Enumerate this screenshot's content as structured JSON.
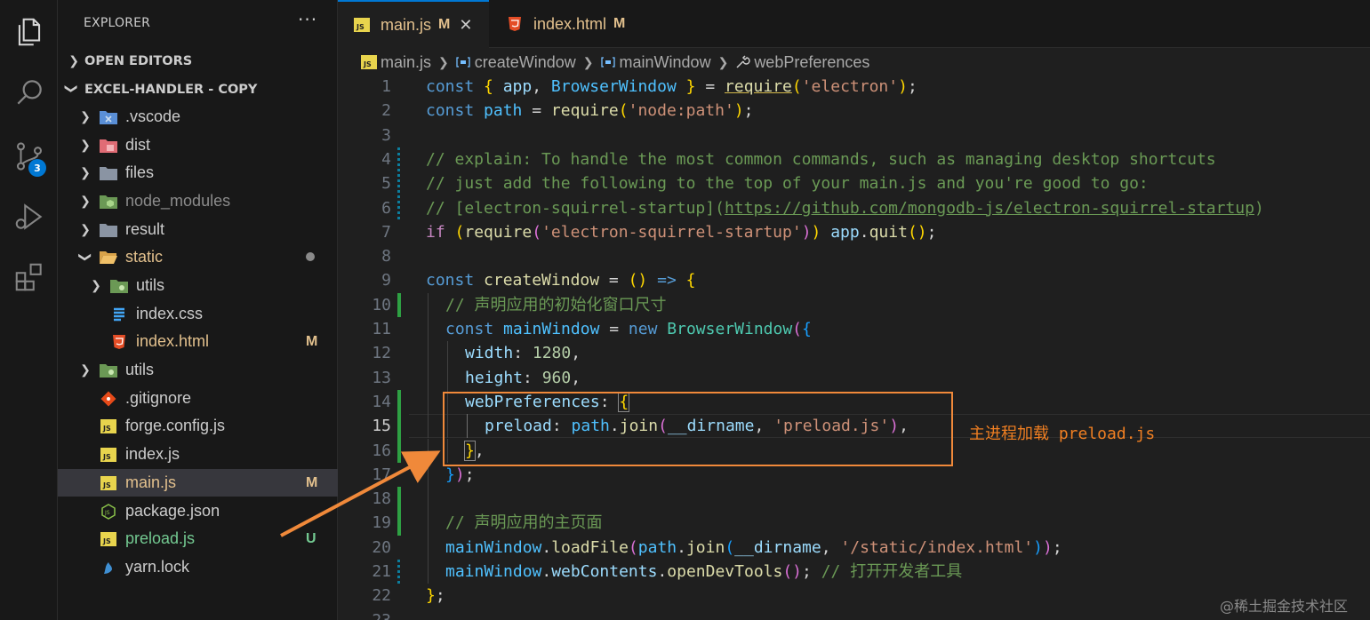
{
  "sidebar": {
    "title": "EXPLORER",
    "more": "···",
    "open_editors": "OPEN EDITORS",
    "project": "EXCEL-HANDLER - COPY",
    "items": [
      {
        "label": ".vscode",
        "status": "",
        "icon": "vscode-folder-icon"
      },
      {
        "label": "dist",
        "status": "",
        "icon": "dist-folder-icon"
      },
      {
        "label": "files",
        "status": "",
        "icon": "folder-icon"
      },
      {
        "label": "node_modules",
        "status": "",
        "icon": "node-folder-icon"
      },
      {
        "label": "result",
        "status": "",
        "icon": "folder-icon"
      },
      {
        "label": "static",
        "status": "",
        "icon": "folder-open-icon"
      },
      {
        "label": "utils",
        "status": "",
        "icon": "utils-folder-icon"
      },
      {
        "label": "index.css",
        "status": "",
        "icon": "css-file-icon"
      },
      {
        "label": "index.html",
        "status": "M",
        "icon": "html-file-icon"
      },
      {
        "label": "utils",
        "status": "",
        "icon": "utils-folder-icon"
      },
      {
        "label": ".gitignore",
        "status": "",
        "icon": "git-file-icon"
      },
      {
        "label": "forge.config.js",
        "status": "",
        "icon": "js-file-icon"
      },
      {
        "label": "index.js",
        "status": "",
        "icon": "js-file-icon"
      },
      {
        "label": "main.js",
        "status": "M",
        "icon": "js-file-icon"
      },
      {
        "label": "package.json",
        "status": "",
        "icon": "node-file-icon"
      },
      {
        "label": "preload.js",
        "status": "U",
        "icon": "js-file-icon"
      },
      {
        "label": "yarn.lock",
        "status": "",
        "icon": "yarn-file-icon"
      }
    ]
  },
  "activity": {
    "scm_badge": "3"
  },
  "tabs": [
    {
      "label": "main.js",
      "status": "M",
      "close": "✕"
    },
    {
      "label": "index.html",
      "status": "M"
    }
  ],
  "breadcrumb": [
    "main.js",
    "createWindow",
    "mainWindow",
    "webPreferences"
  ],
  "line_numbers": [
    "1",
    "2",
    "3",
    "4",
    "5",
    "6",
    "7",
    "8",
    "9",
    "10",
    "11",
    "12",
    "13",
    "14",
    "15",
    "16",
    "17",
    "18",
    "19",
    "20",
    "21",
    "22",
    "23"
  ],
  "code": {
    "l1": [
      "const",
      "{",
      "app",
      "BrowserWindow",
      "}",
      "require",
      "'electron'"
    ],
    "l2": [
      "const",
      "path",
      "require",
      "'node:path'"
    ],
    "l4": "// explain: To handle the most common commands, such as managing desktop shortcuts",
    "l5": "// just add the following to the top of your main.js and you're good to go:",
    "l6a": "// [electron-squirrel-startup](",
    "l6b": "https://github.com/mongodb-js/electron-squirrel-startup",
    "l6c": ")",
    "l7": [
      "if",
      "require",
      "'electron-squirrel-startup'",
      "app",
      "quit"
    ],
    "l9": [
      "const",
      "createWindow",
      "=>"
    ],
    "l10": "// 声明应用的初始化窗口尺寸",
    "l11": [
      "const",
      "mainWindow",
      "new",
      "BrowserWindow"
    ],
    "l12": [
      "width",
      "1280"
    ],
    "l13": [
      "height",
      "960"
    ],
    "l14": [
      "webPreferences"
    ],
    "l15": [
      "preload",
      "path",
      "join",
      "__dirname",
      "'preload.js'"
    ],
    "l19": "// 声明应用的主页面",
    "l20": [
      "mainWindow",
      "loadFile",
      "path",
      "join",
      "__dirname",
      "'/static/index.html'"
    ],
    "l21": [
      "mainWindow",
      "webContents",
      "openDevTools",
      "// 打开开发者工具"
    ]
  },
  "annotation": "主进程加载 preload.js",
  "watermark": "@稀土掘金技术社区",
  "colors": {
    "accent": "#0078d4",
    "annotation": "#f0893a",
    "modified": "#e2c08d",
    "untracked": "#73c991"
  }
}
